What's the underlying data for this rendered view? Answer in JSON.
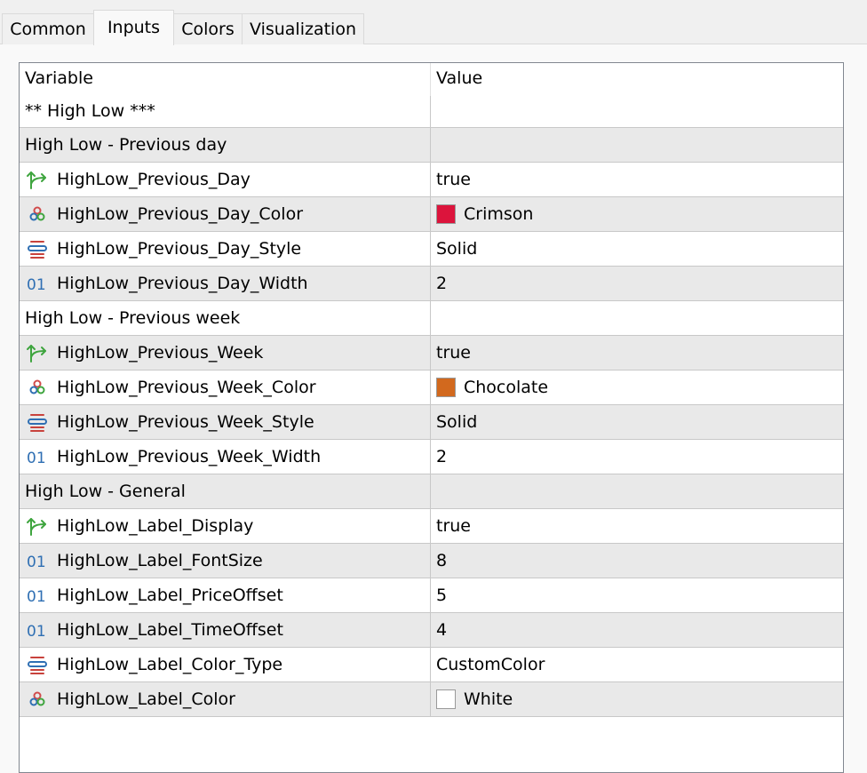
{
  "tabs": [
    {
      "label": "Common",
      "active": false
    },
    {
      "label": "Inputs",
      "active": true
    },
    {
      "label": "Colors",
      "active": false
    },
    {
      "label": "Visualization",
      "active": false
    }
  ],
  "table": {
    "headers": {
      "variable": "Variable",
      "value": "Value"
    },
    "rows": [
      {
        "variable": "** High Low ***",
        "value": "",
        "icon": null
      },
      {
        "variable": "High Low - Previous day",
        "value": "",
        "icon": null
      },
      {
        "variable": "HighLow_Previous_Day",
        "value": "true",
        "icon": "bool-arrow-icon"
      },
      {
        "variable": "HighLow_Previous_Day_Color",
        "value": "Crimson",
        "icon": "color-circles-icon",
        "swatch": "#dc143c"
      },
      {
        "variable": "HighLow_Previous_Day_Style",
        "value": "Solid",
        "icon": "enum-lines-icon"
      },
      {
        "variable": "HighLow_Previous_Day_Width",
        "value": "2",
        "icon": "integer-icon"
      },
      {
        "variable": "High Low - Previous week",
        "value": "",
        "icon": null
      },
      {
        "variable": "HighLow_Previous_Week",
        "value": "true",
        "icon": "bool-arrow-icon"
      },
      {
        "variable": "HighLow_Previous_Week_Color",
        "value": "Chocolate",
        "icon": "color-circles-icon",
        "swatch": "#d2691e"
      },
      {
        "variable": "HighLow_Previous_Week_Style",
        "value": "Solid",
        "icon": "enum-lines-icon"
      },
      {
        "variable": "HighLow_Previous_Week_Width",
        "value": "2",
        "icon": "integer-icon"
      },
      {
        "variable": "High Low - General",
        "value": "",
        "icon": null
      },
      {
        "variable": "HighLow_Label_Display",
        "value": "true",
        "icon": "bool-arrow-icon"
      },
      {
        "variable": "HighLow_Label_FontSize",
        "value": "8",
        "icon": "integer-icon"
      },
      {
        "variable": "HighLow_Label_PriceOffset",
        "value": "5",
        "icon": "integer-icon"
      },
      {
        "variable": "HighLow_Label_TimeOffset",
        "value": "4",
        "icon": "integer-icon"
      },
      {
        "variable": "HighLow_Label_Color_Type",
        "value": "CustomColor",
        "icon": "enum-lines-icon"
      },
      {
        "variable": "HighLow_Label_Color",
        "value": "White",
        "icon": "color-circles-icon",
        "swatch": "#ffffff"
      }
    ]
  },
  "icon_colors": {
    "bool": "#3fa53f",
    "circle_red": "#d14b4b",
    "circle_blue": "#2f6fb3",
    "circle_green": "#3fa53f",
    "enum_red": "#c8423c",
    "enum_blue": "#2f6fb3",
    "integer": "#2f6fb3"
  }
}
